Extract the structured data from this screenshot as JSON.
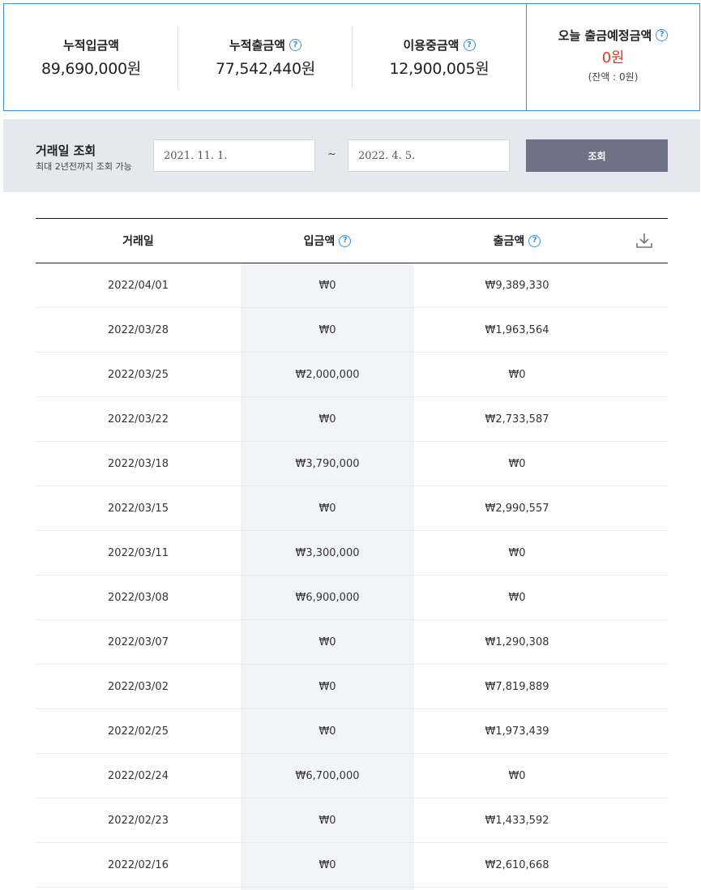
{
  "summary": {
    "cumulative_deposit": {
      "label": "누적입금액",
      "value": "89,690,000원"
    },
    "cumulative_withdrawal": {
      "label": "누적출금액",
      "value": "77,542,440원"
    },
    "in_use": {
      "label": "이용중금액",
      "value": "12,900,005원"
    },
    "scheduled_today": {
      "label": "오늘 출금예정금액",
      "value": "0원",
      "sub": "(잔액 : 0원)"
    },
    "help_glyph": "?",
    "accent_color": "#3b8fd6",
    "highlight_color": "#e8321e"
  },
  "search": {
    "title": "거래일 조회",
    "subtitle": "최대 2년전까지 조회 가능",
    "date_from": "2021. 11. 1.",
    "separator": "~",
    "date_to": "2022. 4. 5.",
    "button_label": "조회",
    "button_color": "#6d7287"
  },
  "table": {
    "headers": {
      "date": "거래일",
      "deposit": "입금액",
      "withdrawal": "출금액"
    },
    "download_icon": "download-icon",
    "rows": [
      {
        "date": "2022/04/01",
        "deposit": "₩0",
        "withdrawal": "₩9,389,330"
      },
      {
        "date": "2022/03/28",
        "deposit": "₩0",
        "withdrawal": "₩1,963,564"
      },
      {
        "date": "2022/03/25",
        "deposit": "₩2,000,000",
        "withdrawal": "₩0"
      },
      {
        "date": "2022/03/22",
        "deposit": "₩0",
        "withdrawal": "₩2,733,587"
      },
      {
        "date": "2022/03/18",
        "deposit": "₩3,790,000",
        "withdrawal": "₩0"
      },
      {
        "date": "2022/03/15",
        "deposit": "₩0",
        "withdrawal": "₩2,990,557"
      },
      {
        "date": "2022/03/11",
        "deposit": "₩3,300,000",
        "withdrawal": "₩0"
      },
      {
        "date": "2022/03/08",
        "deposit": "₩6,900,000",
        "withdrawal": "₩0"
      },
      {
        "date": "2022/03/07",
        "deposit": "₩0",
        "withdrawal": "₩1,290,308"
      },
      {
        "date": "2022/03/02",
        "deposit": "₩0",
        "withdrawal": "₩7,819,889"
      },
      {
        "date": "2022/02/25",
        "deposit": "₩0",
        "withdrawal": "₩1,973,439"
      },
      {
        "date": "2022/02/24",
        "deposit": "₩6,700,000",
        "withdrawal": "₩0"
      },
      {
        "date": "2022/02/23",
        "deposit": "₩0",
        "withdrawal": "₩1,433,592"
      },
      {
        "date": "2022/02/16",
        "deposit": "₩0",
        "withdrawal": "₩2,610,668"
      }
    ]
  }
}
